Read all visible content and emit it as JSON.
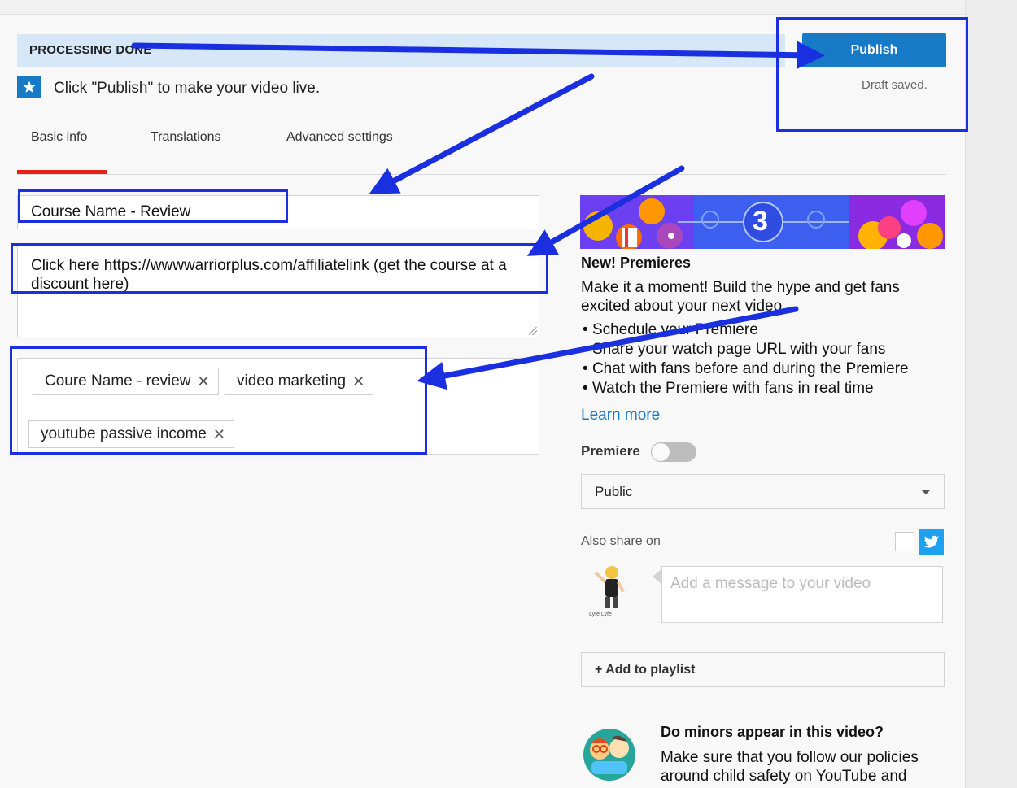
{
  "header": {
    "processing": "PROCESSING DONE",
    "publish": "Publish",
    "draft_status": "Draft saved.",
    "hint": "Click \"Publish\" to make your video live."
  },
  "tabs": [
    {
      "label": "Basic info",
      "active": true
    },
    {
      "label": "Translations",
      "active": false
    },
    {
      "label": "Advanced settings",
      "active": false
    }
  ],
  "form": {
    "title_value": "Course Name  - Review",
    "description_value": "Click here https://wwwwarriorplus.com/affiliatelink (get the course at a discount here)",
    "tags": [
      "Coure Name - review",
      "video marketing",
      "youtube passive income"
    ]
  },
  "premieres": {
    "banner_number": "3",
    "title": "New! Premieres",
    "description": "Make it a moment! Build the hype and get fans excited about your next video",
    "bullets": [
      "Schedule your Premiere",
      "Share your watch page URL with your fans",
      "Chat with fans before and during the Premiere",
      "Watch the Premiere with fans in real time"
    ],
    "learn_more": "Learn more",
    "toggle_label": "Premiere",
    "toggle_on": false
  },
  "visibility": {
    "selected": "Public"
  },
  "share": {
    "label": "Also share on",
    "message_placeholder": "Add a message to your video",
    "avatar_caption": "Lyfe Lyfe"
  },
  "playlist": {
    "label": "+ Add to playlist"
  },
  "minors": {
    "title": "Do minors appear in this video?",
    "description": "Make sure that you follow our policies around child safety on YouTube and"
  },
  "icons": [
    "star-icon",
    "close-icon",
    "chevron-down-icon",
    "twitter-icon",
    "resize-grip-icon"
  ],
  "colors": {
    "brand_blue": "#167ac6",
    "tab_underline": "#e62117",
    "annotation_blue": "#1a2fe0",
    "processing_bg": "#d6e8f7",
    "twitter": "#1da1f2"
  }
}
